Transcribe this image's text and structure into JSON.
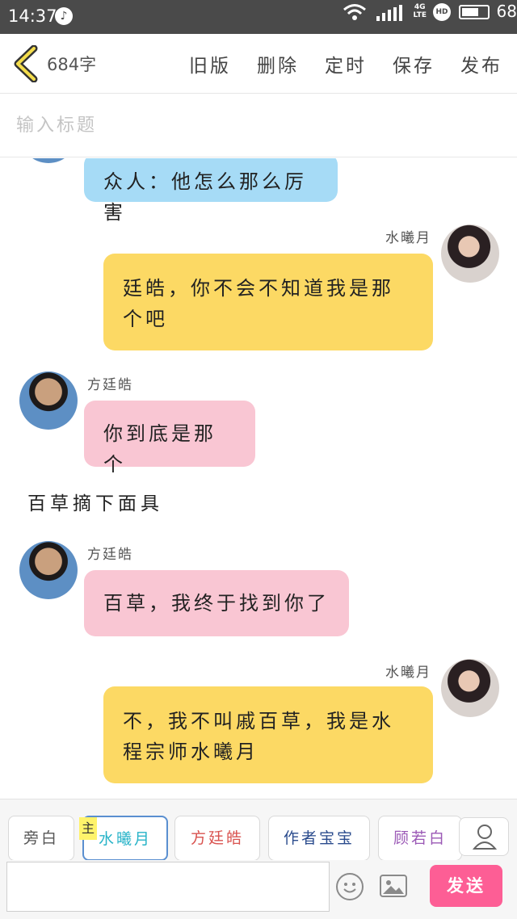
{
  "status_bar": {
    "time": "14:37",
    "network": "4G",
    "network_sub": "LTE",
    "hd": "HD",
    "battery": "68",
    "battery_fraction": 0.68,
    "icons": [
      "music-icon",
      "wifi-icon",
      "signal-icon",
      "battery-icon"
    ]
  },
  "header": {
    "word_count": "684字",
    "menu": {
      "old_version": "旧版",
      "delete": "删除",
      "schedule": "定时",
      "save": "保存",
      "publish": "发布"
    }
  },
  "title": {
    "placeholder": "输入标题"
  },
  "messages": [
    {
      "type": "left",
      "speaker": "",
      "text": "众人：他怎么那么厉害",
      "color": "blue"
    },
    {
      "type": "right",
      "speaker": "水曦月",
      "text": "廷皓，你不会不知道我是那个吧",
      "color": "yellow"
    },
    {
      "type": "left",
      "speaker": "方廷皓",
      "text": "你到底是那个",
      "color": "pink"
    },
    {
      "type": "narration",
      "text": "百草摘下面具"
    },
    {
      "type": "left",
      "speaker": "方廷皓",
      "text": "百草，我终于找到你了",
      "color": "pink"
    },
    {
      "type": "right",
      "speaker": "水曦月",
      "text": "不，我不叫戚百草，我是水程宗师水曦月",
      "color": "yellow"
    }
  ],
  "chat_lines": {
    "m0": "众人：他怎么那么厉害",
    "m1_line1": "廷皓，你不会不知道我是那",
    "m1_line2": "个吧",
    "m2": "你到底是那个",
    "m3": "百草摘下面具",
    "m4": "百草，我终于找到你了",
    "m5_line1": "不，我不叫戚百草，我是水",
    "m5_line2": "程宗师水曦月"
  },
  "speakers": {
    "right": "水曦月",
    "left": "方廷皓"
  },
  "roles": {
    "narrator": "旁白",
    "main_tag": "主",
    "role1": "水曦月",
    "role2": "方廷皓",
    "role3": "作者宝宝",
    "role4": "顾若白"
  },
  "colors": {
    "bubble_blue": "#a6dbf6",
    "bubble_yellow": "#fcd964",
    "bubble_pink": "#f9c6d3",
    "send_button": "#fd5e95",
    "role1_text": "#27b3c8",
    "role2_text": "#d9534f",
    "role3_text": "#2a4b8d",
    "role4_text": "#9b59b6"
  },
  "input": {
    "send": "发送"
  }
}
